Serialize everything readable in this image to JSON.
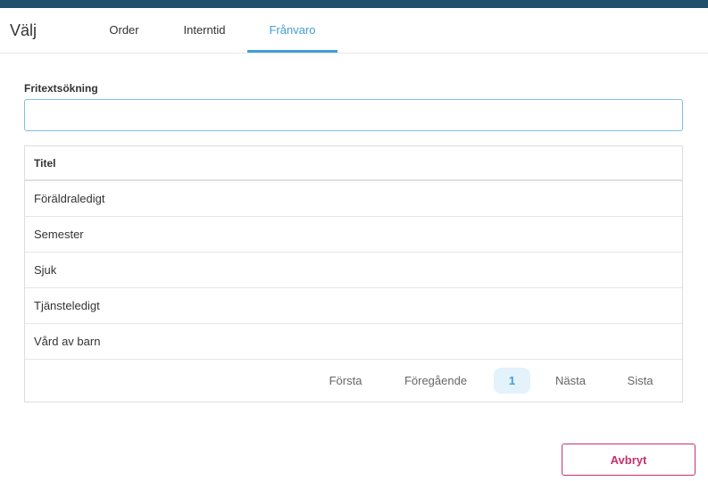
{
  "header": {
    "title": "Välj",
    "tabs": [
      {
        "label": "Order"
      },
      {
        "label": "Interntid"
      },
      {
        "label": "Frånvaro"
      }
    ],
    "active_tab": "Frånvaro"
  },
  "search": {
    "label": "Fritextsökning",
    "value": "",
    "placeholder": ""
  },
  "table": {
    "header": "Titel",
    "rows": [
      "Föräldraledigt",
      "Semester",
      "Sjuk",
      "Tjänsteledigt",
      "Vård av barn"
    ]
  },
  "pagination": {
    "first": "Första",
    "previous": "Föregående",
    "current": "1",
    "next": "Nästa",
    "last": "Sista"
  },
  "footer": {
    "cancel_label": "Avbryt"
  },
  "colors": {
    "top_bar": "#1f4f6b",
    "accent": "#3f9fd6",
    "cancel": "#c8316e"
  }
}
